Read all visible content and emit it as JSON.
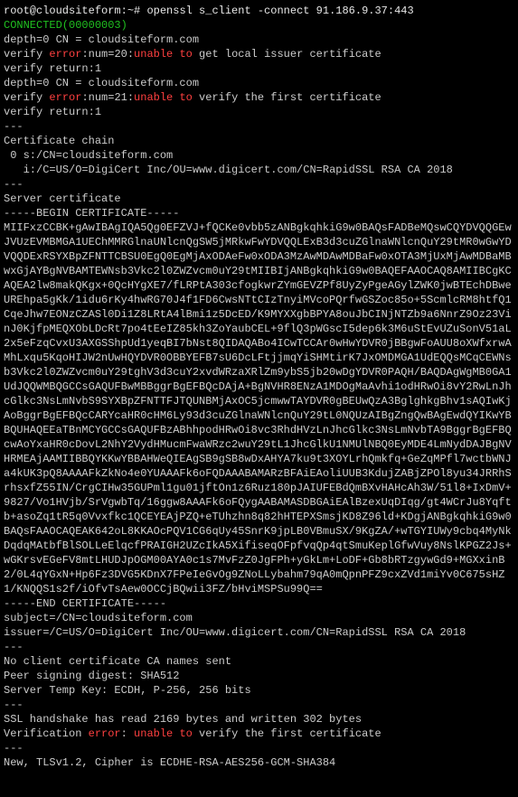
{
  "prompt": {
    "user_host": "root@cloudsiteform:~# ",
    "cmd": "openssl s_client -connect ",
    "ip": "91.186.9.37:443"
  },
  "connected": "CONNECTED(00000003)",
  "depth0_a": "depth=0 CN = cloudsiteform.com",
  "verify1_pre": "verify ",
  "verify1_err": "error",
  "verify1_mid": ":num=20:",
  "verify1_un": "unable to",
  "verify1_post": " get local issuer certificate",
  "return1": "verify return:1",
  "depth0_b": "depth=0 CN = cloudsiteform.com",
  "verify2_pre": "verify ",
  "verify2_err": "error",
  "verify2_mid": ":num=21:",
  "verify2_un": "unable to",
  "verify2_post": " verify the first certificate",
  "return2": "verify return:1",
  "sep": "---",
  "certchain_hdr": "Certificate chain",
  "chain0": " 0 s:/CN=cloudsiteform.com",
  "chain_i": "   i:/C=US/O=DigiCert Inc/OU=www.digicert.com/CN=RapidSSL RSA CA 2018",
  "servercert_hdr": "Server certificate",
  "begin_cert": "-----BEGIN CERTIFICATE-----",
  "cert_body": "MIIFxzCCBK+gAwIBAgIQA5Qg0EFZVJ+fQCKe0vbb5zANBgkqhkiG9w0BAQsFADBeMQswCQYDVQQGEwJVUzEVMBMGA1UEChMMRGlnaUNlcnQgSW5jMRkwFwYDVQQLExB3d3cuZGlnaWNlcnQuY29tMR0wGwYDVQQDExRSYXBpZFNTTCBSU0EgQ0EgMjAxODAeFw0xODA3MzAwMDAwMDBaFw0xOTA3MjUxMjAwMDBaMBwxGjAYBgNVBAMTEWNsb3Vkc2l0ZWZvcm0uY29tMIIBIjANBgkqhkiG9w0BAQEFAAOCAQ8AMIIBCgKCAQEA2lw8makQKgx+0QcHYgXE7/fLRPtA303cfogkwrZYmGEVZPf8UyZyPgeAGylZWK0jwBTEchDBweUREhpa5gKk/1idu6rKy4hwRG70J4f1FD6CwsNTtCIzTnyiMVcoPQrfwGSZoc85o+5ScmlcRM8htfQ1CqeJhw7EONzCZASl0Di1Z8LRtA4lBmi1z5DcED/K9MYXXgbBPYA8ouJbCINjNTZb9a6NnrZ9Oz23VinJ0KjfpMEQXObLDcRt7po4tEeIZ85kh3ZoYaubCEL+9flQ3pWGscI5dep6k3M6uStEvUZuSonV51aL2x5eFzqCvxU3AXGSShpUd1yeqBI7bNst8QIDAQABo4ICwTCCAr0wHwYDVR0jBBgwFoAUU8oXWfxrwAMhLxqu5KqoHIJW2nUwHQYDVR0OBBYEFB7sU6DcLFtjjmqYiSHMtirK7JxOMDMGA1UdEQQsMCqCEWNsb3Vkc2l0ZWZvcm0uY29tghV3d3cuY2xvdWRzaXRlZm9ybS5jb20wDgYDVR0PAQH/BAQDAgWgMB0GA1UdJQQWMBQGCCsGAQUFBwMBBggrBgEFBQcDAjA+BgNVHR8ENzA1MDOgMaAvhi1odHRwOi8vY2RwLnJhcGlkc3NsLmNvbS9SYXBpZFNTTFJTQUNBMjAxOC5jcmwwTAYDVR0gBEUwQzA3BglghkgBhv1sAQIwKjAoBggrBgEFBQcCARYcaHR0cHM6Ly93d3cuZGlnaWNlcnQuY29tL0NQUzAIBgZngQwBAgEwdQYIKwYBBQUHAQEEaTBnMCYGCCsGAQUFBzABhhpodHRwOi8vc3RhdHVzLnJhcGlkc3NsLmNvbTA9BggrBgEFBQcwAoYxaHR0cDovL2NhY2VydHMucmFwaWRzc2wuY29tL1JhcGlkU1NMUlNBQ0EyMDE4LmNydDAJBgNVHRMEAjAAMIIBBQYKKwYBBAHWeQIEAgSB9gSB8wDxAHYA7ku9t3XOYLrhQmkfq+GeZqMPfl7wctbWNJa4kUK3pQ8AAAAFkZkNo4e0YUAAAFk6oFQDAAABAMARzBFAiEAoliUUB3KdujZABjZPOl8yu34JRRhSrhsxfZ55IN/CrgCIHw35GUPml1gu01jftOn1z6Ruz180pJAIUFEBdQmBXvHAHcAh3W/51l8+IxDmV+9827/Vo1HVjb/SrVgwbTq/16ggw8AAAFk6oFQygAABAMASDBGAiEAlBzexUqDIqg/gt4WCrJu8Yqftb+asoZq1tR5q0Vvxfkc1QCEYEAjPZQ+eTUhzhn8q82hHTEPXSmsjKD8Z96ld+KDgjANBgkqhkiG9w0BAQsFAAOCAQEAK642oL8KKAOcPQV1CG6qUy45SnrK9jpLB0VBmuSX/9KgZA/+wTGYIUWy9cbq4MyNkDqdqMAtbfBlSOLLeElqcfPRAIGH2UZcIkA5XifiseqOFpfvqQp4qtSmuKeplGfwVuy8NslKPGZ2Js+wGKrsvEGeFV8mtLHUDJpOGM00AYA0c1s7MvFzZ0JgFPh+yGkLm+LoDF+Gb8bRTzgywGd9+MGXxinB2/0L4qYGxN+Hp6Fz3DVG5KDnX7FPeIeGvOg9ZNoLLybahm79qA0mQpnPFZ9cxZVd1miYv0C675sHZ1/KNQQS1s2f/iOfvTsAew0OCCjBQwii3FZ/bHviMSPSu99Q==",
  "end_cert": "-----END CERTIFICATE-----",
  "subject": "subject=/CN=cloudsiteform.com",
  "issuer": "issuer=/C=US/O=DigiCert Inc/OU=www.digicert.com/CN=RapidSSL RSA CA 2018",
  "no_client": "No client certificate CA names sent",
  "peer_sign": "Peer signing digest: SHA512",
  "server_temp": "Server Temp Key: ECDH, P-256, 256 bits",
  "handshake": "SSL handshake has read 2169 bytes and written 302 bytes",
  "verif_pre": "Verification ",
  "verif_err": "error",
  "verif_mid": ": ",
  "verif_un": "unable to",
  "verif_post": " verify the first certificate",
  "cipher": "New, TLSv1.2, Cipher is ECDHE-RSA-AES256-GCM-SHA384"
}
